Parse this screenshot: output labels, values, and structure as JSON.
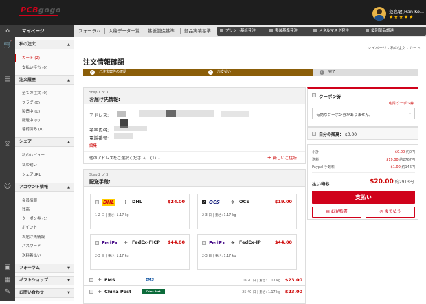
{
  "header": {
    "logo_a": "PCB",
    "logo_b": "gogo",
    "user_name": "范高敏(Han Ko...",
    "stars": "★★★★★"
  },
  "nav": {
    "mypage": "マイページ",
    "items": [
      "フォーラム",
      "入稿データ一覧",
      "基板製造基準",
      "部品実装基準"
    ],
    "dark_items": [
      "プリント基板発注",
      "実装基準発注",
      "メタルマスク発注",
      "個別部品調達"
    ]
  },
  "sidebar": {
    "sections": [
      {
        "title": "私の注文",
        "items": [
          "カート (2)",
          "支払い待ち (0)"
        ]
      },
      {
        "title": "注文履歴",
        "items": [
          "全ての注文 (0)",
          "フラグ (0)",
          "製造中 (0)",
          "配送中 (0)",
          "着荷済み (0)"
        ]
      },
      {
        "title": "シェア",
        "items": [
          "私のレビュー",
          "私の誘い",
          "シェアURL"
        ]
      },
      {
        "title": "アカウント情報",
        "items": [
          "会員情報",
          "残高",
          "クーポン券 (1)",
          "ポイント",
          "お届け先情報",
          "パスワード",
          "送料着払い"
        ]
      },
      {
        "title": "フォーラム",
        "items": []
      },
      {
        "title": "ギフトショップ",
        "items": []
      },
      {
        "title": "お問い合わせ",
        "items": []
      }
    ]
  },
  "breadcrumb": "マイページ - 私の注文 - カート",
  "page_title": "注文情報確認",
  "progress": {
    "step1": "ご注文案件の確認",
    "step2": "お支払い",
    "step3": "完了"
  },
  "step1": {
    "step": "Step 1 of 3",
    "title": "お届け先情報:",
    "address_label": "アドレス:",
    "english_name_label": "英字氏名:",
    "phone_label": "電話番号:",
    "edit": "編集",
    "other_address": "他のアドレスをご選択ください。",
    "other_count": "(1)",
    "new_address": "新しいご住所"
  },
  "step2": {
    "step": "Step 2 of 3",
    "title": "配送手段:",
    "options": [
      {
        "logo": "DHL",
        "name": "DHL",
        "price": "$24.00",
        "detail": "1-2 日 | 重さ: 1.17 kg",
        "checked": false,
        "color": "#d40511",
        "bg": "#ffcc00"
      },
      {
        "logo": "OCS",
        "name": "OCS",
        "price": "$19.00",
        "detail": "2-3 日 | 重さ: 1.17 kg",
        "checked": true,
        "color": "#1a237e",
        "bg": "#fff"
      },
      {
        "logo": "FedEx",
        "name": "FedEx-FICP",
        "price": "$44.00",
        "detail": "2-3 日 | 重さ: 1.17 kg",
        "checked": false,
        "color": "#4d148c",
        "bg": "#fff"
      },
      {
        "logo": "FedEx",
        "name": "FedEx-IP",
        "price": "$44.00",
        "detail": "2-3 日 | 重さ: 1.17 kg",
        "checked": false,
        "color": "#4d148c",
        "bg": "#fff"
      }
    ],
    "rows": [
      {
        "logo": "EMS",
        "name": "EMS",
        "price": "$23.00",
        "detail": "10-20 日 | 重さ: 1.17 kg"
      },
      {
        "logo": "China Post",
        "name": "China Post",
        "price": "$23.00",
        "detail": "25-40 日 | 重さ: 1.17 kg"
      }
    ]
  },
  "coupon": {
    "title": "クーポン券",
    "count_link": "0割引クーポン券",
    "select": "有効なクーポン券がありません。"
  },
  "balance": {
    "label": "自分の残高：",
    "value": "$0.00"
  },
  "summary": {
    "subtotal_label": "小計",
    "subtotal": "$0.00",
    "subtotal_jpy": "約0円",
    "shipping_label": "送料",
    "shipping": "$19.00",
    "shipping_jpy": "約2767円",
    "paypal_label": "Paypal 手数料",
    "paypal": "$1.00",
    "paypal_jpy": "約146円",
    "due_label": "払い待ち",
    "due": "$20.00",
    "due_jpy": "約2913円",
    "pay_button": "支払い",
    "quote_button": "お見積書",
    "later_button": "後で払う"
  },
  "colors": {
    "accent": "#d0021b",
    "brown": "#8b5e09"
  }
}
